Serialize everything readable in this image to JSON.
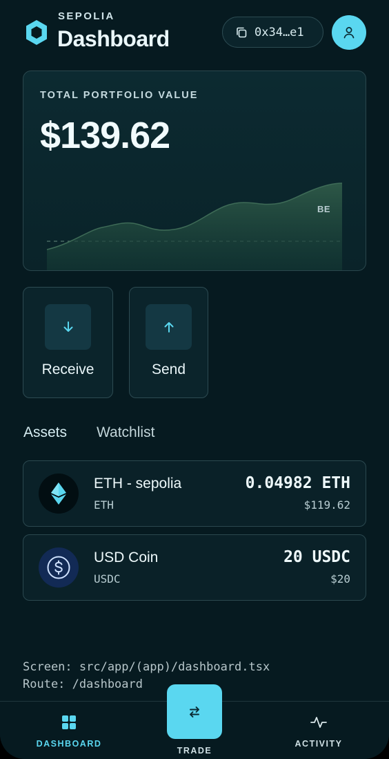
{
  "header": {
    "network": "SEPOLIA",
    "title": "Dashboard",
    "address": "0x34…e1",
    "copy_icon": "copy-icon",
    "avatar_icon": "user-icon"
  },
  "portfolio": {
    "label": "TOTAL PORTFOLIO VALUE",
    "value": "$139.62",
    "chart_badge": "BE"
  },
  "actions": [
    {
      "label": "Receive",
      "icon": "arrow-down-icon"
    },
    {
      "label": "Send",
      "icon": "arrow-up-icon"
    }
  ],
  "tabs": [
    {
      "label": "Assets",
      "active": true
    },
    {
      "label": "Watchlist",
      "active": false
    }
  ],
  "assets": [
    {
      "name": "ETH - sepolia",
      "symbol": "ETH",
      "amount": "0.04982 ETH",
      "usd": "$119.62",
      "icon": "ethereum-icon"
    },
    {
      "name": "USD Coin",
      "symbol": "USDC",
      "amount": "20 USDC",
      "usd": "$20",
      "icon": "dollar-coin-icon"
    }
  ],
  "debug": {
    "screen": "Screen: src/app/(app)/dashboard.tsx",
    "route": "Route: /dashboard"
  },
  "nav": {
    "dashboard": "DASHBOARD",
    "trade": "TRADE",
    "activity": "ACTIVITY"
  },
  "colors": {
    "background": "#061a20",
    "accent": "#5ad7f0",
    "chart_fill": "#2f5a48"
  }
}
